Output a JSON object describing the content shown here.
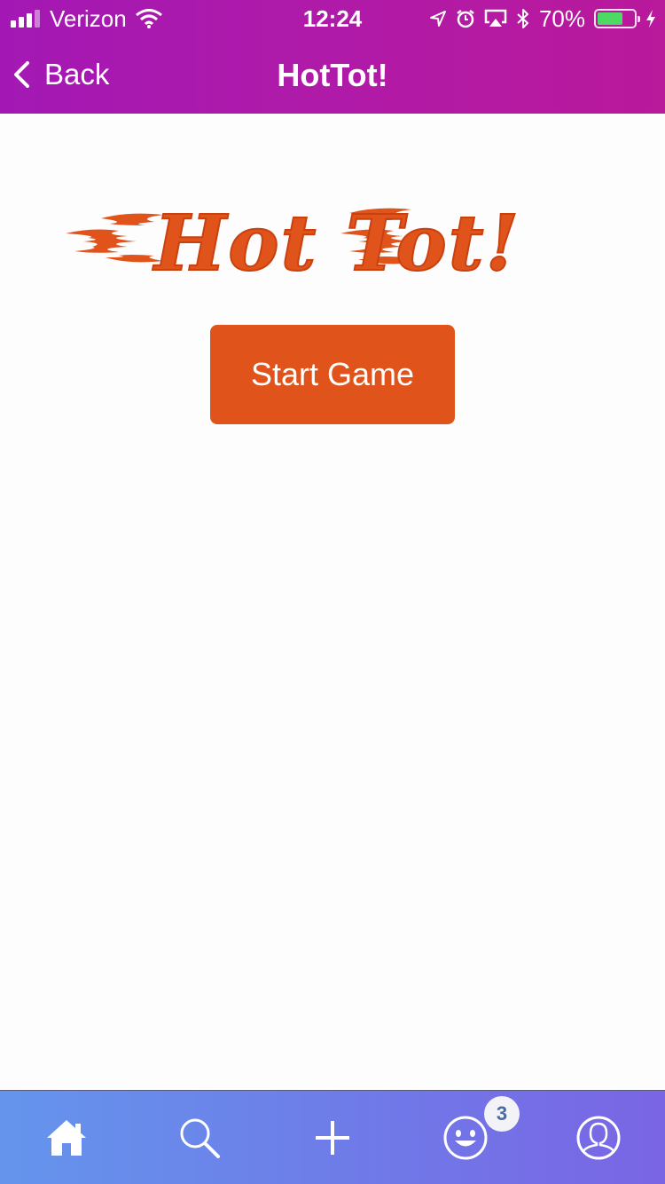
{
  "status_bar": {
    "carrier": "Verizon",
    "time": "12:24",
    "battery_percent": "70%",
    "battery_level": 0.7,
    "icons": [
      "signal-icon",
      "wifi-icon",
      "location-icon",
      "alarm-icon",
      "airplay-icon",
      "bluetooth-icon",
      "battery-icon",
      "charging-icon"
    ]
  },
  "nav": {
    "back_label": "Back",
    "title": "HotTot!"
  },
  "main": {
    "logo_text": "Hot Tot!",
    "start_button_label": "Start Game"
  },
  "tab_bar": {
    "tabs": [
      {
        "icon": "home-icon",
        "active": true
      },
      {
        "icon": "search-icon",
        "active": false
      },
      {
        "icon": "plus-icon",
        "active": false
      },
      {
        "icon": "smiley-icon",
        "active": false
      },
      {
        "icon": "profile-icon",
        "active": false
      }
    ],
    "notifications_badge": "3"
  },
  "colors": {
    "header_gradient_start": "#a318b4",
    "header_gradient_end": "#b9199b",
    "accent_orange": "#e0531b",
    "tab_bar_gradient_start": "#6495ec",
    "tab_bar_gradient_end": "#7a65e4",
    "battery_green": "#4cd964"
  }
}
